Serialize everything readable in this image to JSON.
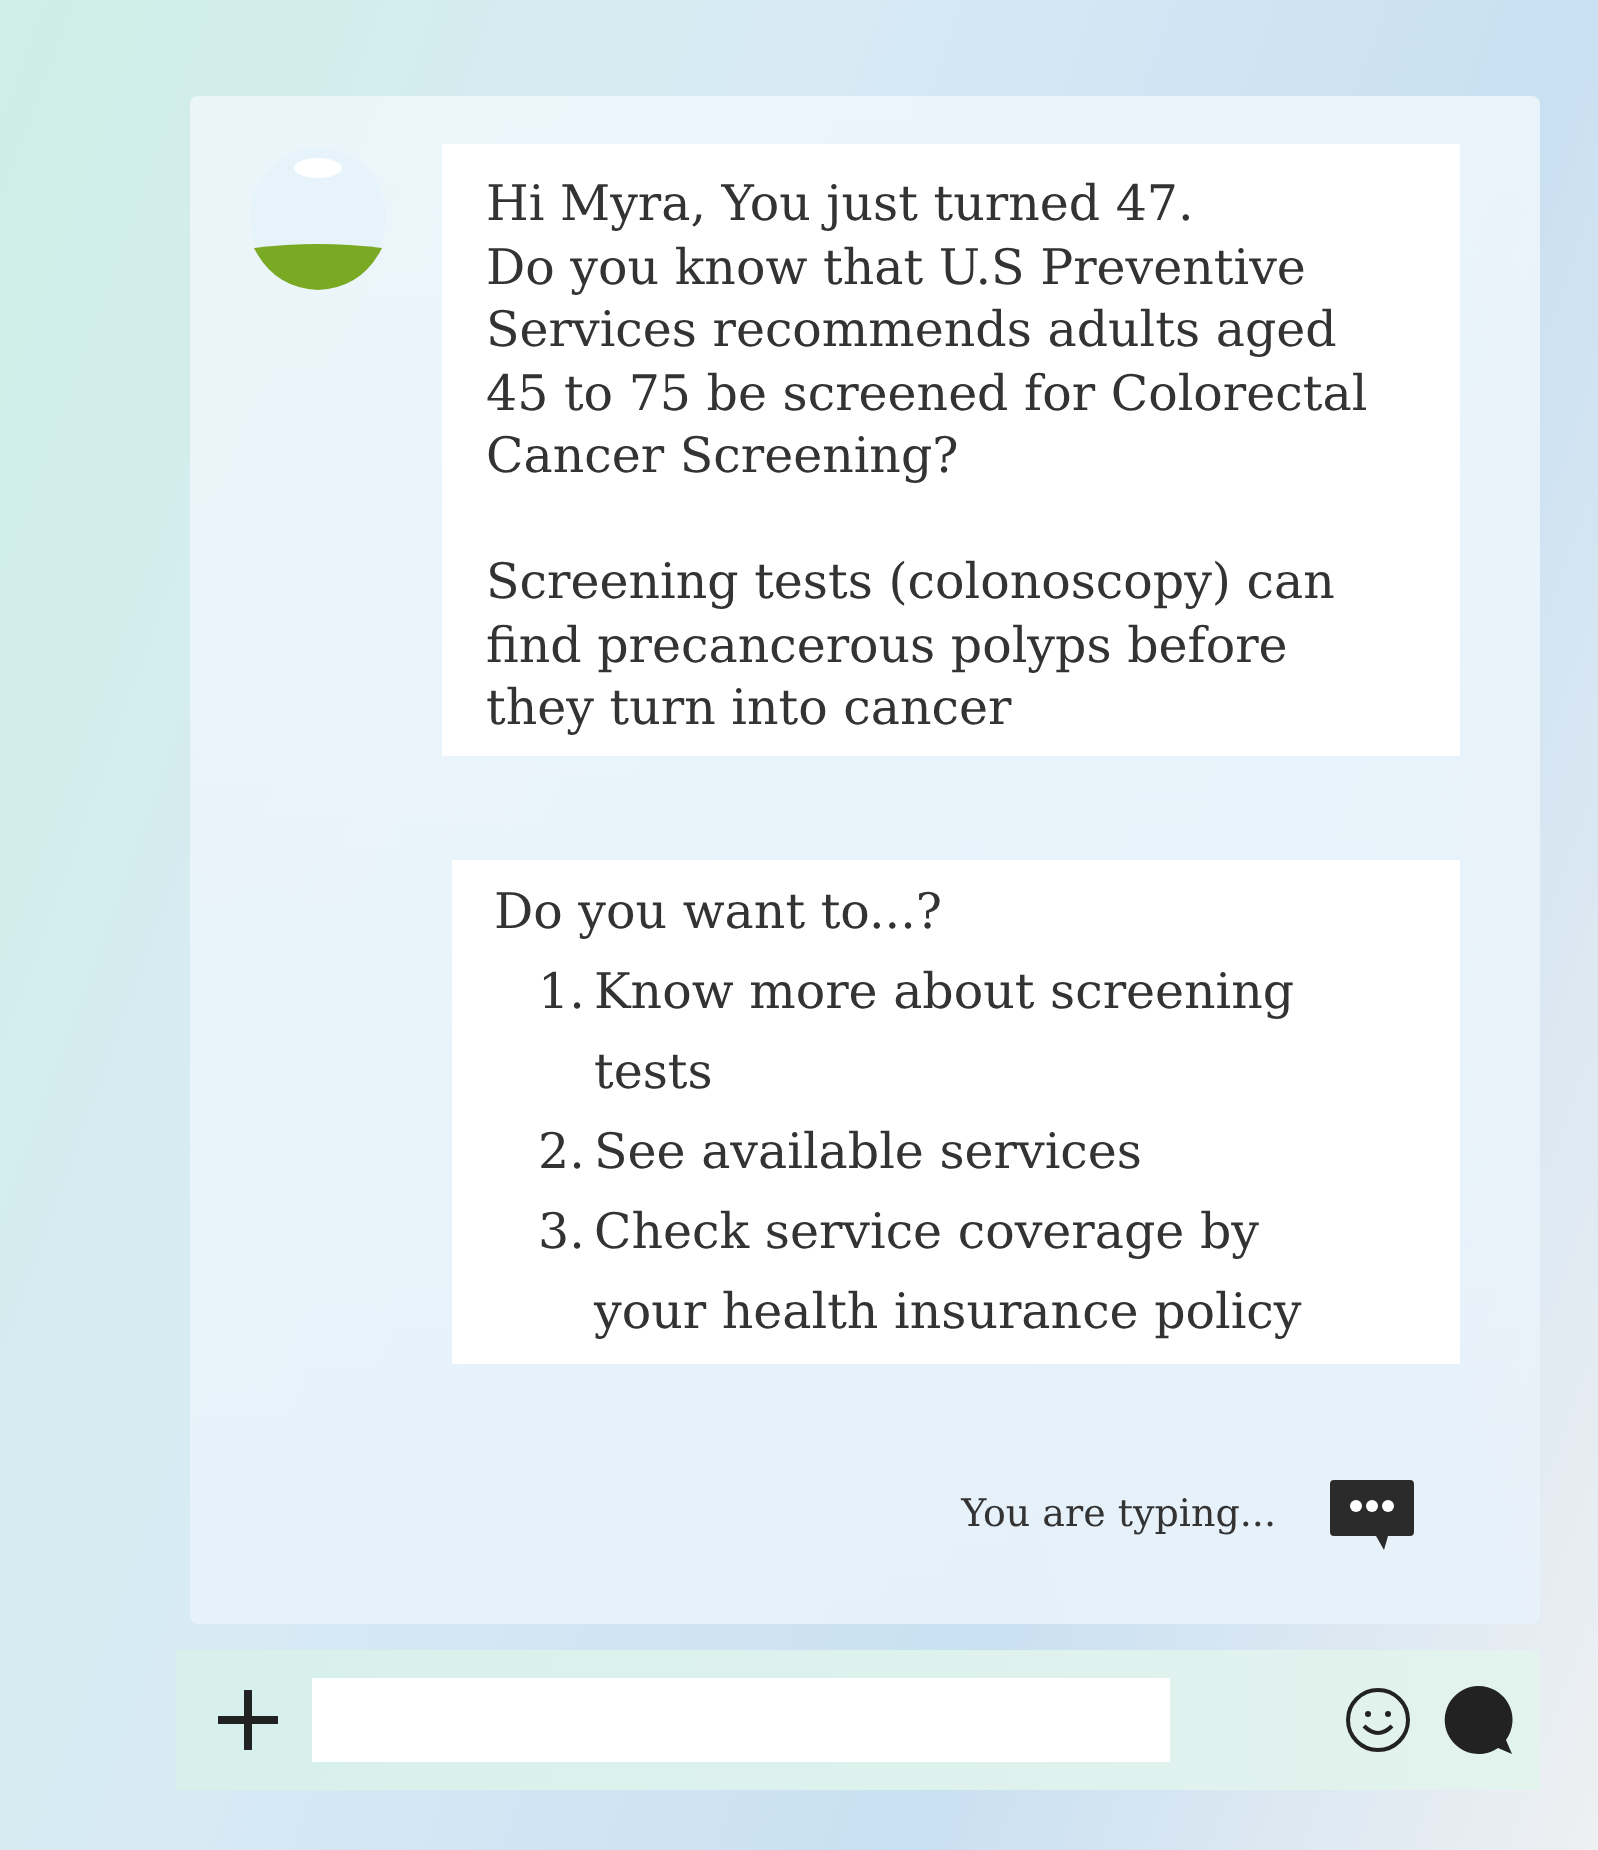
{
  "messages": [
    {
      "kind": "text",
      "paragraphs": [
        "Hi Myra, You just turned 47.\nDo you know that U.S Preventive\nServices recommends adults aged\n45 to 75 be screened for Colorectal\nCancer Screening?",
        "Screening tests (colonoscopy) can\nfind precancerous polyps before\nthey turn into cancer"
      ]
    },
    {
      "kind": "options",
      "prompt": "Do you want to...?",
      "options": [
        {
          "number": "1.",
          "text": "Know more about screening\ntests"
        },
        {
          "number": "2.",
          "text": "See available services"
        },
        {
          "number": "3.",
          "text": "Check service coverage by\nyour health insurance policy"
        }
      ]
    }
  ],
  "typing_status": "You are typing..."
}
